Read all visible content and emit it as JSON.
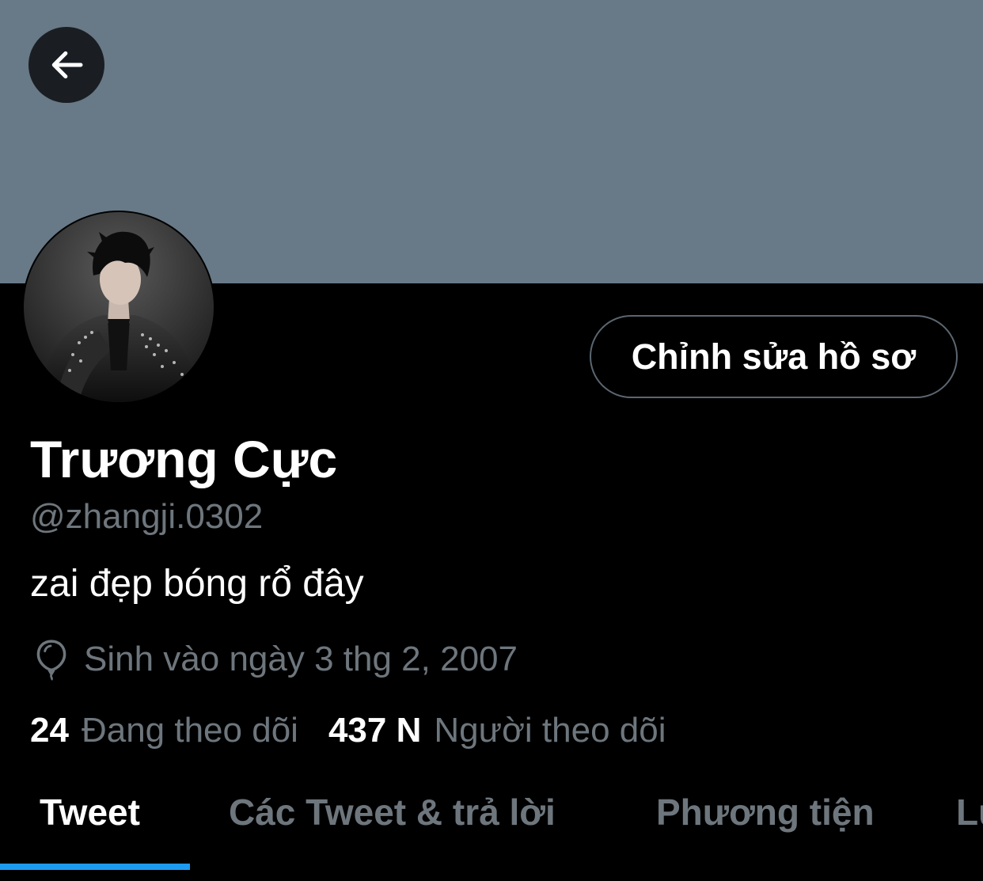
{
  "header": {
    "back_icon": "arrow-left-icon",
    "banner_color": "#687987"
  },
  "profile": {
    "display_name": "Trương Cực",
    "handle": "@zhangji.0302",
    "bio": "zai đẹp bóng rổ đây",
    "birthday_icon": "balloon-icon",
    "birthday": "Sinh vào ngày 3 thg 2, 2007",
    "edit_button_label": "Chỉnh sửa hồ sơ"
  },
  "stats": {
    "following_count": "24",
    "following_label": "Đang theo dõi",
    "followers_count": "437 N",
    "followers_label": "Người theo dõi"
  },
  "tabs": [
    {
      "label": "Tweet",
      "active": true
    },
    {
      "label": "Các Tweet & trả lời",
      "active": false
    },
    {
      "label": "Phương tiện",
      "active": false
    },
    {
      "label": "Lư",
      "active": false
    }
  ],
  "colors": {
    "accent": "#1d9bf0",
    "secondary_text": "#6e767d",
    "background": "#000000"
  }
}
